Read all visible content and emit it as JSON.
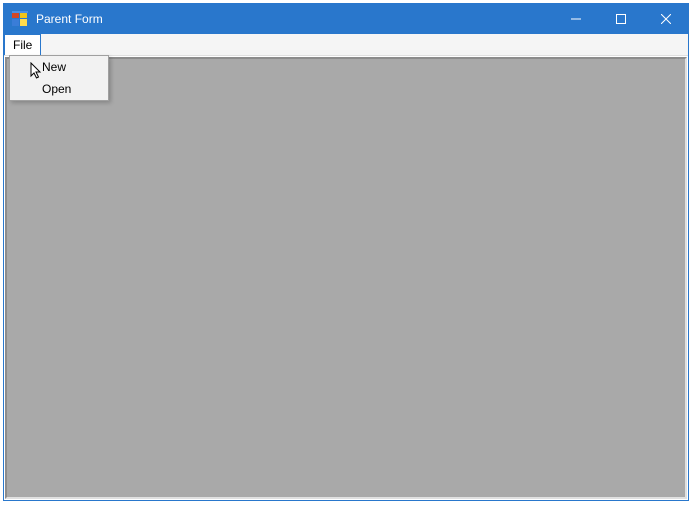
{
  "window": {
    "title": "Parent Form"
  },
  "menubar": {
    "file": {
      "label": "File",
      "items": [
        {
          "label": "New"
        },
        {
          "label": "Open"
        }
      ]
    }
  }
}
